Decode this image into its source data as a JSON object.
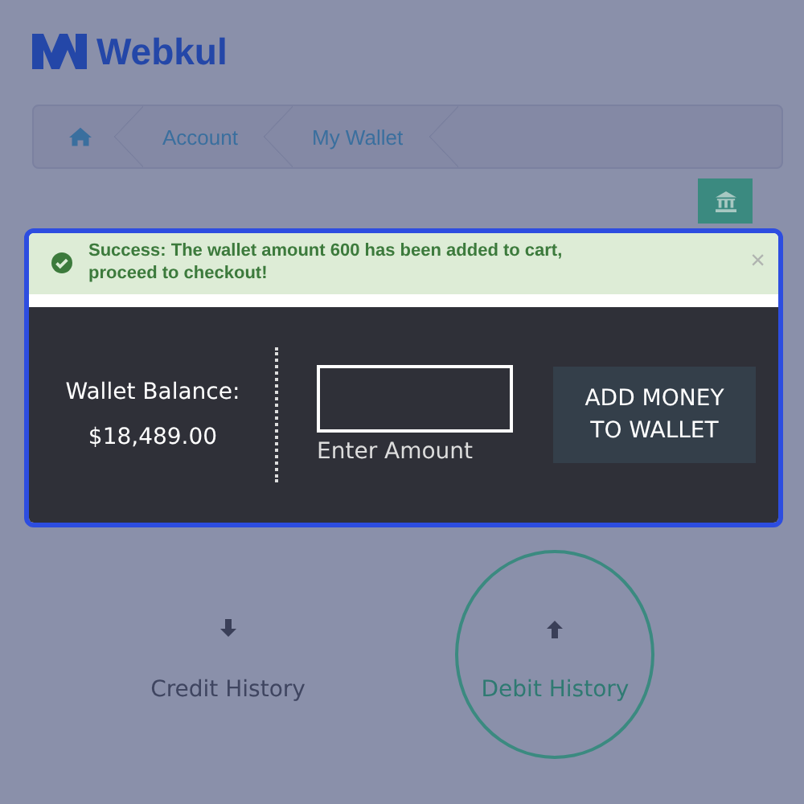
{
  "logo": {
    "text": "Webkul"
  },
  "breadcrumb": [
    "Account",
    "My Wallet"
  ],
  "alert": {
    "message": "Success: The wallet amount 600 has been added to cart, proceed to checkout!",
    "close": "×"
  },
  "wallet": {
    "balance_label": "Wallet Balance:",
    "balance": "$18,489.00",
    "amount_label": "Enter Amount",
    "button": "ADD MONEY TO WALLET"
  },
  "history_tabs": [
    {
      "label": "Credit History",
      "kind": "credit",
      "selected": false
    },
    {
      "label": "Debit History",
      "kind": "debit",
      "selected": true
    }
  ]
}
